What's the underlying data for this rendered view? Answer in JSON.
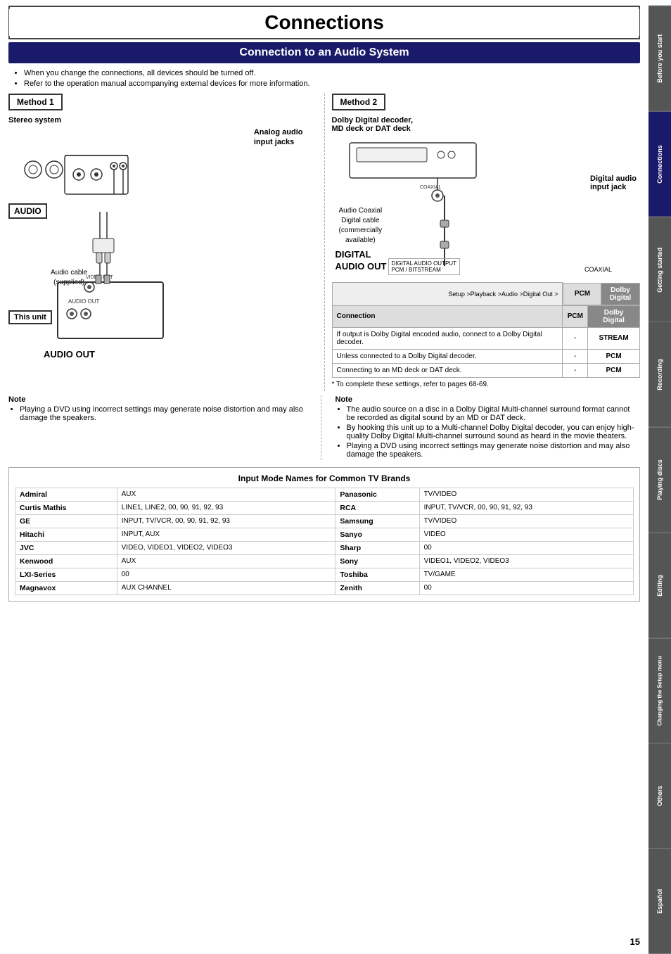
{
  "page": {
    "title": "Connections",
    "page_number": "15"
  },
  "section": {
    "title": "Connection to an Audio System"
  },
  "intro": {
    "bullets": [
      "When you change the connections, all devices should be turned off.",
      "Refer to the operation manual accompanying external devices for more information."
    ]
  },
  "method1": {
    "label": "Method 1",
    "system_label": "Stereo system",
    "analog_label": "Analog audio\ninput jacks",
    "audio_label": "AUDIO",
    "cable_label": "Audio cable\n(supplied)",
    "this_unit_label": "This unit",
    "audio_out_label": "AUDIO OUT"
  },
  "method2": {
    "label": "Method 2",
    "system_label": "Dolby Digital decoder,\nMD deck or DAT deck",
    "digital_label": "Digital audio\ninput jack",
    "digital_cable_label": "Audio Coaxial\nDigital cable\n(commercially\navailable)",
    "digital_out_label": "DIGITAL\nAUDIO OUT",
    "coaxial_label": "COAXIAL",
    "pcm_label": "PCM / BITSTREAM"
  },
  "settings_table": {
    "setup_path": "Setup >Playback >Audio >Digital Out >",
    "col1": "Connection",
    "col2": "PCM",
    "col3": "Dolby Digital",
    "rows": [
      {
        "connection": "If output is Dolby Digital encoded audio, connect to a Dolby Digital decoder.",
        "pcm": "-",
        "dolby": "STREAM"
      },
      {
        "connection": "Unless connected to a Dolby Digital decoder.",
        "pcm": "-",
        "dolby": "PCM"
      },
      {
        "connection": "Connecting to an MD deck or DAT deck.",
        "pcm": "-",
        "dolby": "PCM"
      }
    ],
    "ref_note": "* To complete these settings, refer to pages 68-69."
  },
  "note_left": {
    "title": "Note",
    "bullets": [
      "Playing a DVD using incorrect settings may generate noise distortion and may also damage the speakers."
    ]
  },
  "note_right": {
    "title": "Note",
    "bullets": [
      "The audio source on a disc in a Dolby Digital Multi-channel surround format cannot be recorded as digital sound by an MD or DAT deck.",
      "By hooking this unit up to a Multi-channel Dolby Digital decoder, you can enjoy high-quality Dolby Digital Multi-channel surround sound as heard in the movie theaters.",
      "Playing a DVD using incorrect settings may generate noise distortion and may also damage the speakers."
    ]
  },
  "brand_table": {
    "title": "Input Mode Names for Common TV Brands",
    "brands": [
      {
        "name": "Admiral",
        "value": "AUX",
        "name2": "Panasonic",
        "value2": "TV/VIDEO"
      },
      {
        "name": "Curtis Mathis",
        "value": "LINE1, LINE2, 00, 90, 91, 92, 93",
        "name2": "RCA",
        "value2": "INPUT, TV/VCR, 00, 90, 91, 92, 93"
      },
      {
        "name": "GE",
        "value": "INPUT, TV/VCR, 00, 90, 91, 92, 93",
        "name2": "Samsung",
        "value2": "TV/VIDEO"
      },
      {
        "name": "Hitachi",
        "value": "INPUT, AUX",
        "name2": "Sanyo",
        "value2": "VIDEO"
      },
      {
        "name": "JVC",
        "value": "VIDEO, VIDEO1, VIDEO2, VIDEO3",
        "name2": "Sharp",
        "value2": "00"
      },
      {
        "name": "Kenwood",
        "value": "AUX",
        "name2": "Sony",
        "value2": "VIDEO1, VIDEO2, VIDEO3"
      },
      {
        "name": "LXI-Series",
        "value": "00",
        "name2": "Toshiba",
        "value2": "TV/GAME"
      },
      {
        "name": "Magnavox",
        "value": "AUX CHANNEL",
        "name2": "Zenith",
        "value2": "00"
      }
    ]
  },
  "sidebar_tabs": [
    {
      "label": "Before you start"
    },
    {
      "label": "Connections"
    },
    {
      "label": "Getting started"
    },
    {
      "label": "Recording"
    },
    {
      "label": "Playing discs"
    },
    {
      "label": "Editing"
    },
    {
      "label": "Changing the Setup menu"
    },
    {
      "label": "Others"
    },
    {
      "label": "Español"
    }
  ]
}
